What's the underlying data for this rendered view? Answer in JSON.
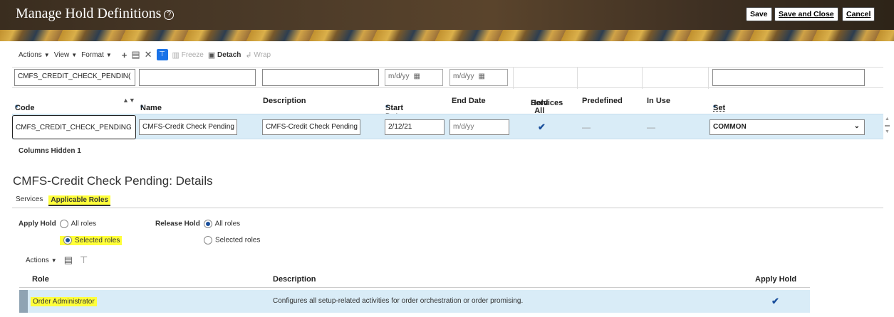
{
  "header": {
    "title": "Manage Hold Definitions",
    "help_symbol": "?",
    "save": "Save",
    "save_close": "Save and Close",
    "cancel": "Cancel"
  },
  "toolbar": {
    "actions": "Actions",
    "view": "View",
    "format": "Format",
    "freeze": "Freeze",
    "detach": "Detach",
    "wrap": "Wrap"
  },
  "filters": {
    "code": "CMFS_CREDIT_CHECK_PENDIN(",
    "name": "",
    "description": "",
    "start_placeholder": "m/d/yy",
    "end_placeholder": "m/d/yy",
    "set": ""
  },
  "columns": {
    "code": "Code",
    "name": "Name",
    "description": "Description",
    "start_date": "Start Date",
    "end_date": "End Date",
    "hold_all_1": "Hold All",
    "hold_all_2": "Services",
    "predefined": "Predefined",
    "in_use": "In Use",
    "set": "Set",
    "required_mark": "*"
  },
  "row": {
    "code": "CMFS_CREDIT_CHECK_PENDING",
    "name": "CMFS-Credit Check Pending",
    "description": "CMFS-Credit Check Pending",
    "start_date": "2/12/21",
    "end_date_placeholder": "m/d/yy",
    "hold_all_services": true,
    "predefined": "—",
    "in_use": "—",
    "set": "COMMON"
  },
  "columns_hidden": {
    "label": "Columns Hidden",
    "count": "1"
  },
  "details": {
    "title": "CMFS-Credit Check Pending: Details",
    "tabs": [
      "Services",
      "Applicable Roles"
    ],
    "active_tab": "Applicable Roles"
  },
  "apply_hold": {
    "label": "Apply Hold",
    "options": [
      "All roles",
      "Selected roles"
    ],
    "selected": "Selected roles"
  },
  "release_hold": {
    "label": "Release Hold",
    "options": [
      "All roles",
      "Selected roles"
    ],
    "selected": "All roles"
  },
  "roles_toolbar": {
    "actions": "Actions"
  },
  "roles_table": {
    "headers": [
      "Role",
      "Description",
      "Apply Hold"
    ],
    "rows": [
      {
        "role": "Order Administrator",
        "description": "Configures all setup-related activities for order orchestration or order promising.",
        "apply_hold": true
      }
    ]
  },
  "colors": {
    "highlight": "#ffff3a",
    "row_selected": "#d9ecf7",
    "accent": "#1a4f9c"
  }
}
